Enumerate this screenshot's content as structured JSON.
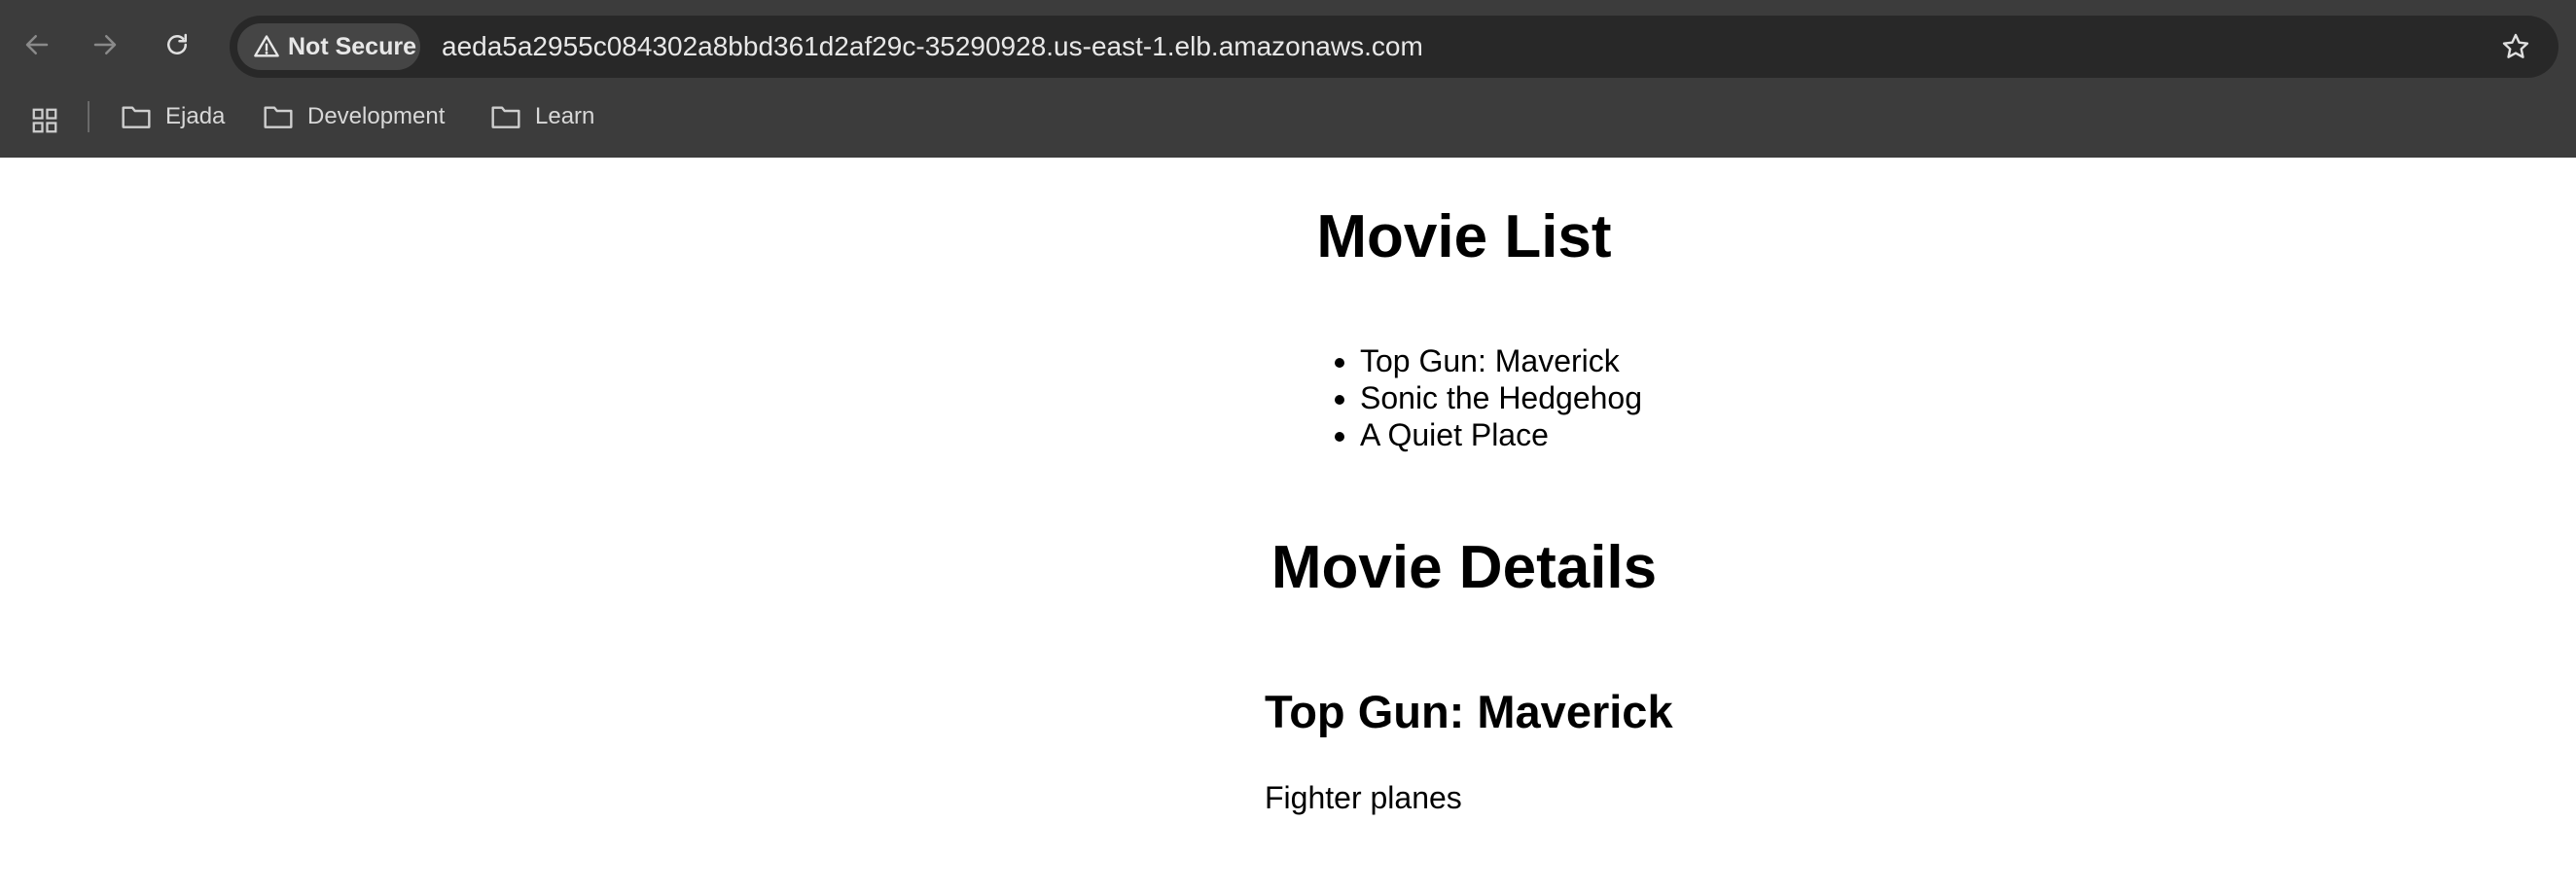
{
  "browser": {
    "security_chip": "Not Secure",
    "url": "aeda5a2955c084302a8bbd361d2af29c-35290928.us-east-1.elb.amazonaws.com",
    "bookmarks": [
      {
        "label": "Ejada",
        "icon": "folder-icon"
      },
      {
        "label": "Development",
        "icon": "folder-icon"
      },
      {
        "label": "Learn",
        "icon": "folder-icon"
      }
    ],
    "icons": {
      "back": "back-arrow-icon",
      "forward": "forward-arrow-icon",
      "reload": "reload-icon",
      "warning": "warning-icon",
      "bookmark_star": "star-icon",
      "apps": "apps-grid-icon"
    },
    "colors": {
      "chrome_bg": "#3c3c3c",
      "omnibox_bg": "#282828",
      "chip_bg": "#454545"
    }
  },
  "page": {
    "list_heading": "Movie List",
    "movies": [
      "Top Gun: Maverick",
      "Sonic the Hedgehog",
      "A Quiet Place"
    ],
    "details_heading": "Movie Details",
    "selected_title": "Top Gun: Maverick",
    "selected_description": "Fighter planes"
  }
}
